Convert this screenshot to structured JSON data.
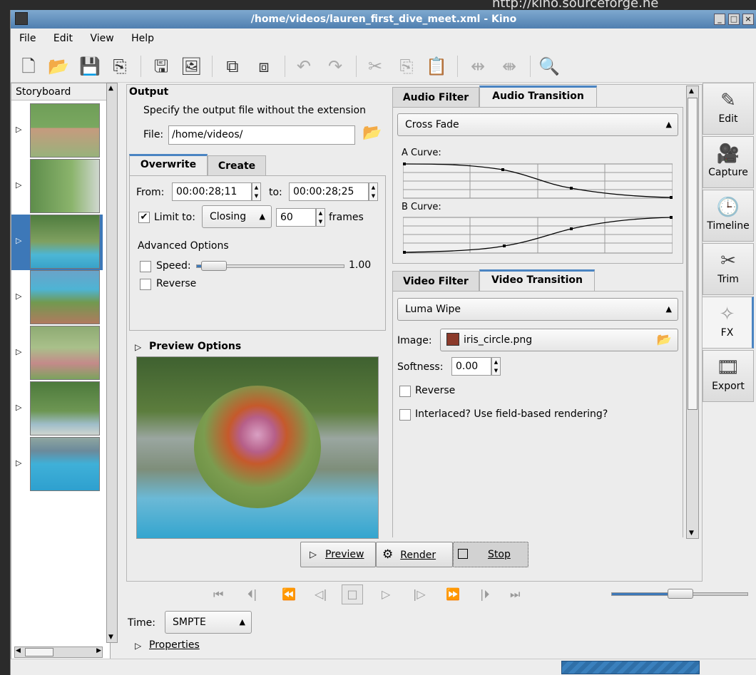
{
  "window": {
    "title": "/home/videos/lauren_first_dive_meet.xml - Kino",
    "url_fragment": "http://kino.sourceforge.ne"
  },
  "menu": [
    {
      "label": "File"
    },
    {
      "label": "Edit"
    },
    {
      "label": "View"
    },
    {
      "label": "Help"
    }
  ],
  "storyboard": {
    "title": "Storyboard",
    "clip_count": 7,
    "selected_index": 2
  },
  "output": {
    "title": "Output",
    "hint": "Specify the output file without the extension",
    "file_label": "File:",
    "file_value": "/home/videos/",
    "tabs": [
      "Overwrite",
      "Create"
    ],
    "from_label": "From:",
    "from_value": "00:00:28;11",
    "to_label": "to:",
    "to_value": "00:00:28;25",
    "limit_label": "Limit to:",
    "limit_checked": true,
    "limit_mode": "Closing",
    "limit_frames": "60",
    "frames_label": "frames",
    "advanced_title": "Advanced Options",
    "speed_label": "Speed:",
    "speed_value": "1.00",
    "reverse_label": "Reverse"
  },
  "preview": {
    "options_label": "Preview Options"
  },
  "audio": {
    "tabs": [
      "Audio Filter",
      "Audio Transition"
    ],
    "selected": "Cross Fade",
    "a_curve_label": "A Curve:",
    "b_curve_label": "B Curve:"
  },
  "video": {
    "tabs": [
      "Video Filter",
      "Video Transition"
    ],
    "selected": "Luma Wipe",
    "image_label": "Image:",
    "image_file": "iris_circle.png",
    "softness_label": "Softness:",
    "softness_value": "0.00",
    "reverse_label": "Reverse",
    "interlaced_label": "Interlaced? Use field-based rendering?"
  },
  "actions": {
    "preview": "Preview",
    "render": "Render",
    "stop": "Stop"
  },
  "time": {
    "label": "Time:",
    "format": "SMPTE"
  },
  "properties_label": "Properties",
  "side_nav": [
    {
      "label": "Edit",
      "icon": "edit-icon"
    },
    {
      "label": "Capture",
      "icon": "camera-icon"
    },
    {
      "label": "Timeline",
      "icon": "clock-icon"
    },
    {
      "label": "Trim",
      "icon": "trim-icon"
    },
    {
      "label": "FX",
      "icon": "fx-icon",
      "active": true
    },
    {
      "label": "Export",
      "icon": "export-icon"
    }
  ],
  "colors": {
    "accent": "#4a84c2",
    "title_bar": "#5f8dbd",
    "selected": "#3d78b8"
  }
}
